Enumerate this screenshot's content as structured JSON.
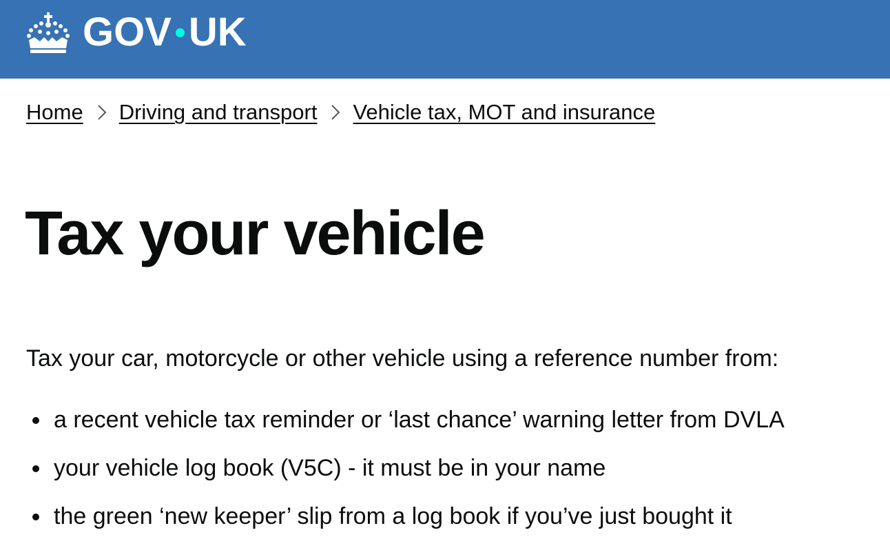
{
  "header": {
    "logo_text_left": "GOV",
    "logo_text_right": "UK",
    "logo_icon": "crown-icon",
    "background_color": "#3672b4",
    "dot_color": "#00ffe0"
  },
  "breadcrumb": {
    "items": [
      {
        "label": "Home"
      },
      {
        "label": "Driving and transport"
      },
      {
        "label": "Vehicle tax, MOT and insurance"
      }
    ],
    "separator_icon": "chevron-right-icon"
  },
  "main": {
    "title": "Tax your vehicle",
    "intro": "Tax your car, motorcycle or other vehicle using a reference number from:",
    "list": [
      "a recent vehicle tax reminder or ‘last chance’ warning letter from DVLA",
      "your vehicle log book (V5C) - it must be in your name",
      "the green ‘new keeper’ slip from a log book if you’ve just bought it"
    ]
  }
}
